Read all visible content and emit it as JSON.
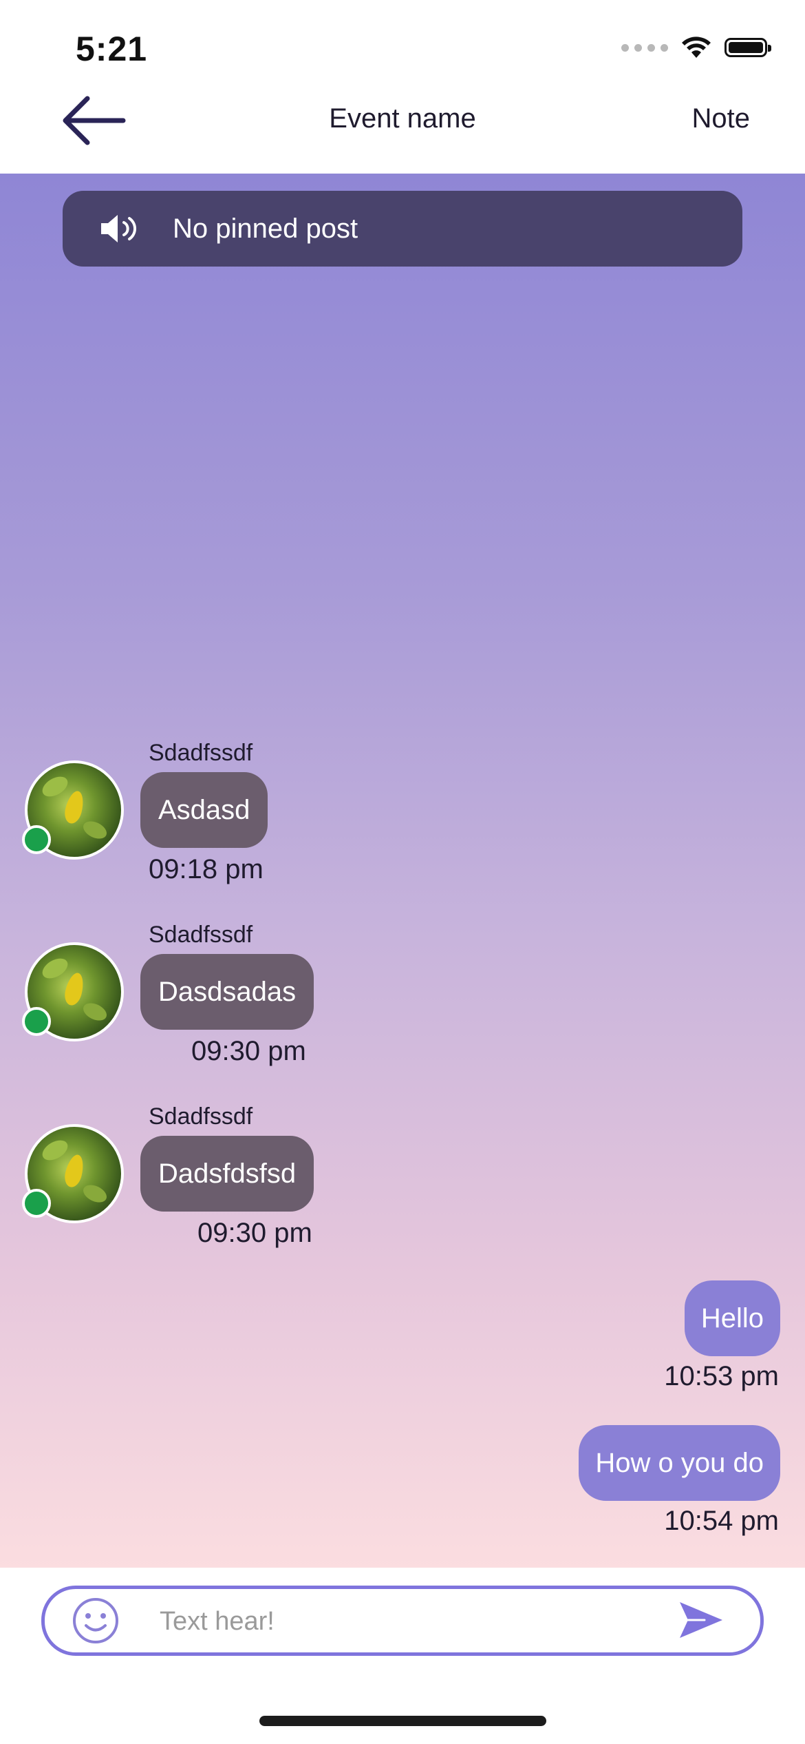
{
  "status_bar": {
    "time": "5:21"
  },
  "header": {
    "title": "Event name",
    "note_label": "Note"
  },
  "pinned": {
    "text": "No pinned post"
  },
  "messages": [
    {
      "sender": "Sdadfssdf",
      "text": "Asdasd",
      "time": "09:18 pm",
      "direction": "incoming"
    },
    {
      "sender": "Sdadfssdf",
      "text": "Dasdsadas",
      "time": "09:30 pm",
      "direction": "incoming"
    },
    {
      "sender": "Sdadfssdf",
      "text": "Dadsfdsfsd",
      "time": "09:30 pm",
      "direction": "incoming"
    },
    {
      "text": "Hello",
      "time": "10:53 pm",
      "direction": "outgoing"
    },
    {
      "text": "How o you do",
      "time": "10:54 pm",
      "direction": "outgoing"
    }
  ],
  "composer": {
    "placeholder": "Text hear!",
    "value": ""
  },
  "icons": {
    "back": "arrow-left-icon",
    "speaker": "speaker-icon",
    "emoji": "smiley-icon",
    "send": "send-icon",
    "wifi": "wifi-icon",
    "battery": "battery-icon"
  },
  "colors": {
    "pinned_bg": "#49436c",
    "incoming_bubble": "#6b5d6d",
    "outgoing_bubble": "#8a80d6",
    "accent": "#7f74dd",
    "online": "#1aa04b"
  }
}
